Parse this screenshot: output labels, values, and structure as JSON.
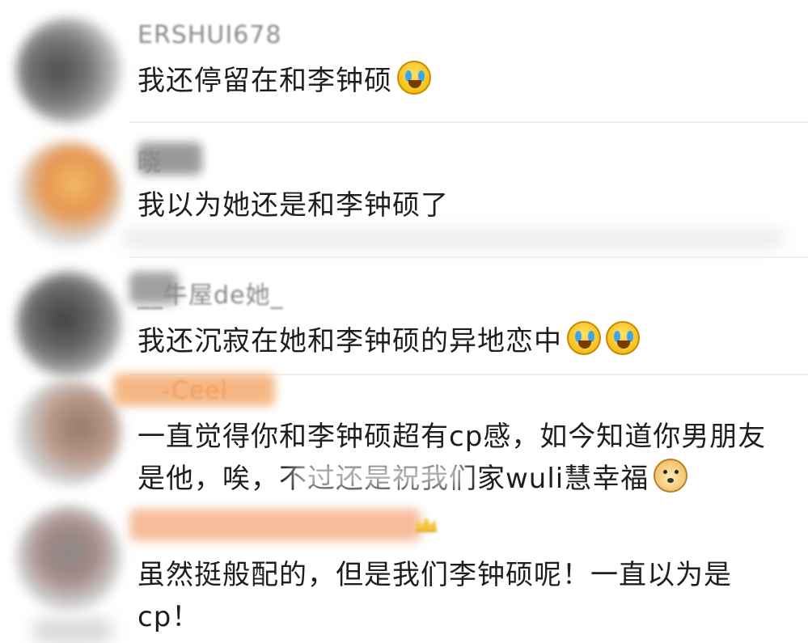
{
  "comments": [
    {
      "username": "ERSHUI678",
      "text": "我还停留在和李钟硕",
      "emojis": [
        "laughing-crying-emoji"
      ]
    },
    {
      "username": "晓",
      "text": "我以为她还是和李钟硕了",
      "emojis": []
    },
    {
      "username": "__牛屋de她_",
      "text": "我还沉寂在她和李钟硕的异地恋中",
      "emojis": [
        "laughing-crying-emoji",
        "laughing-crying-emoji"
      ]
    },
    {
      "username": "-Ceel",
      "text": "一直觉得你和李钟硕超有cp感，如今知道你男朋友是他，唉，不过还是祝我们家wuli慧幸福",
      "emojis": [
        "doge-emoji"
      ]
    },
    {
      "username": "",
      "text": "虽然挺般配的，但是我们李钟硕呢！一直以为是cp！",
      "emojis": []
    }
  ],
  "colors": {
    "username": "#8a8a8a",
    "text": "#1e1e1e",
    "username_highlight": "#f0a060",
    "divider": "#efefef"
  }
}
